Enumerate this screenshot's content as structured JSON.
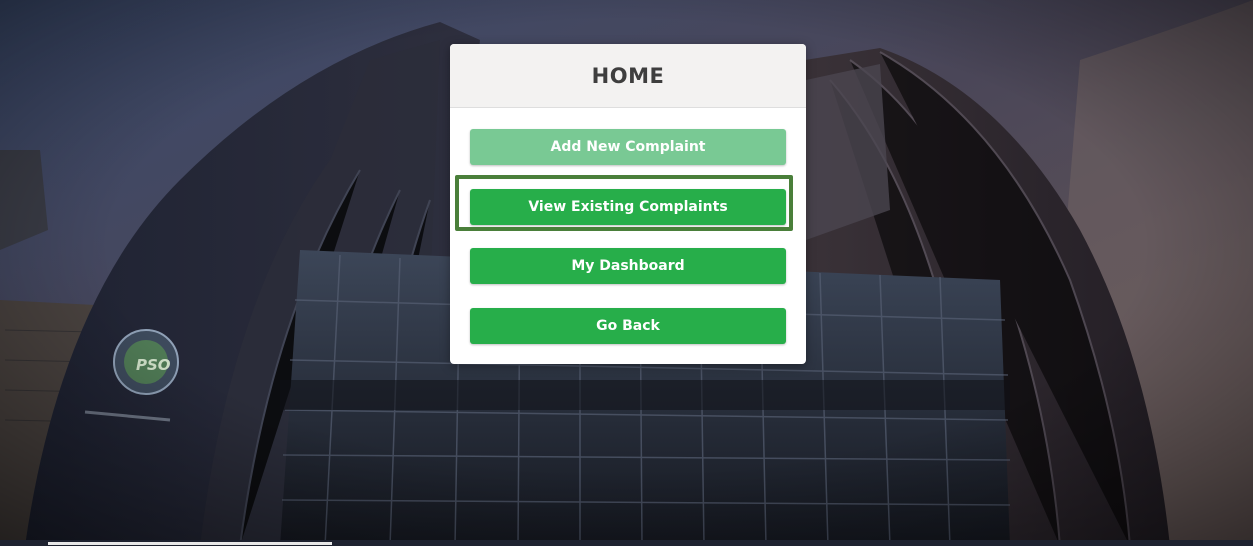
{
  "page": {
    "title": "HOME"
  },
  "menu": {
    "items": [
      {
        "label": "Add New Complaint",
        "state": "faded"
      },
      {
        "label": "View Existing Complaints",
        "state": "highlighted"
      },
      {
        "label": "My Dashboard",
        "state": "normal"
      },
      {
        "label": "Go Back",
        "state": "normal"
      }
    ]
  },
  "colors": {
    "button_green": "#27ae4a",
    "button_faded": "#79c994",
    "highlight_border": "#4a7f3a",
    "header_bg": "#f3f2f1"
  }
}
